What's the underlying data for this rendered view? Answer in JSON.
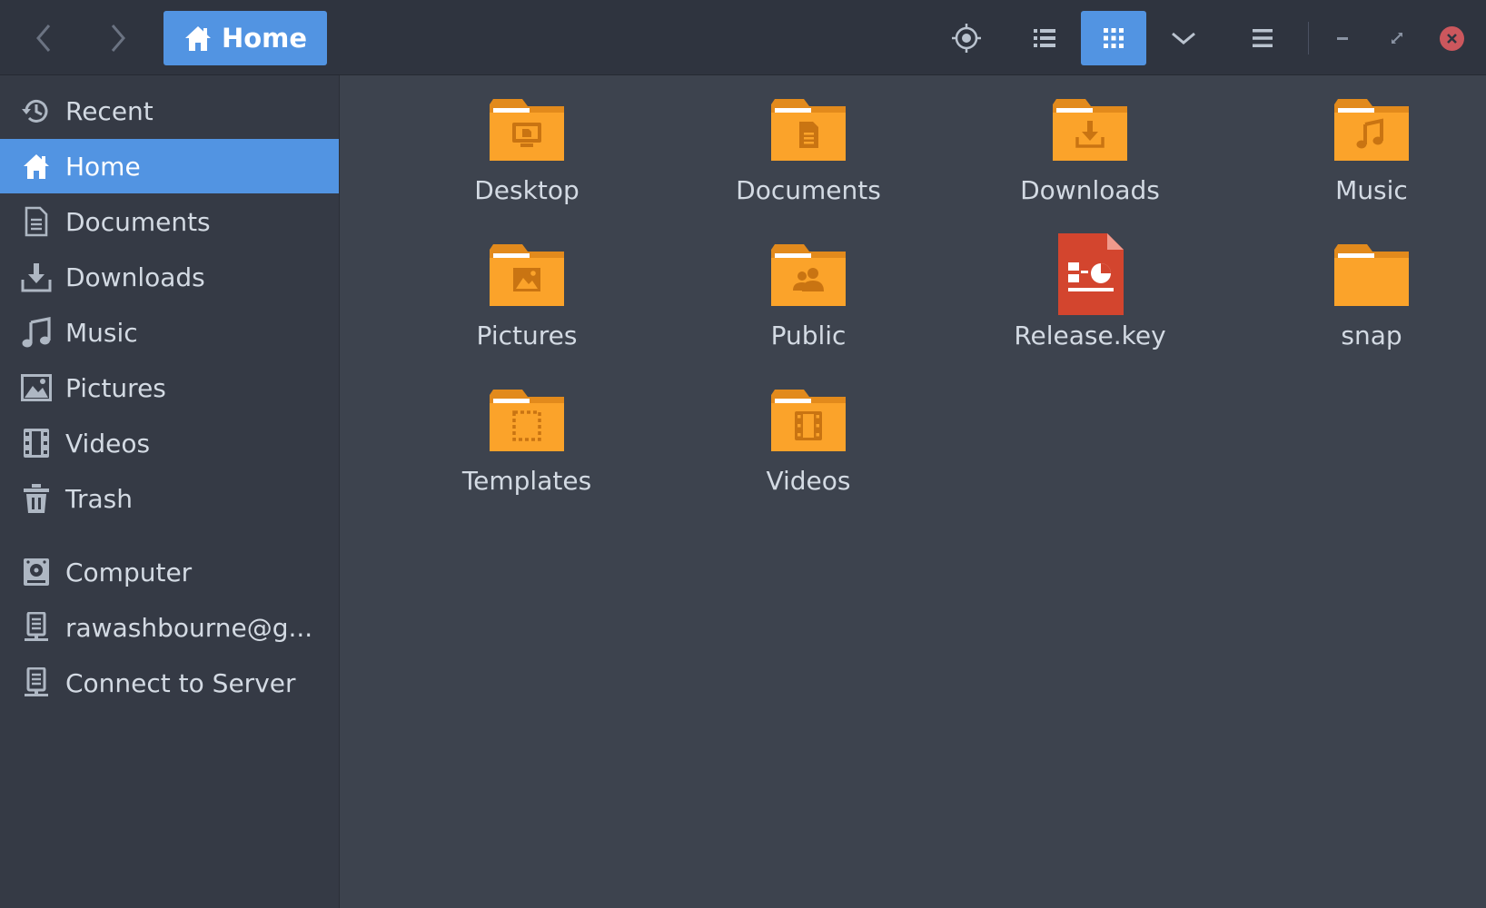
{
  "header": {
    "breadcrumb_label": "Home"
  },
  "sidebar": {
    "items": [
      {
        "label": "Recent",
        "icon": "recent-icon"
      },
      {
        "label": "Home",
        "icon": "home-icon",
        "active": true
      },
      {
        "label": "Documents",
        "icon": "documents-icon"
      },
      {
        "label": "Downloads",
        "icon": "downloads-icon"
      },
      {
        "label": "Music",
        "icon": "music-icon"
      },
      {
        "label": "Pictures",
        "icon": "pictures-icon"
      },
      {
        "label": "Videos",
        "icon": "videos-icon"
      },
      {
        "label": "Trash",
        "icon": "trash-icon"
      },
      {
        "label": "Computer",
        "icon": "computer-icon"
      },
      {
        "label": "rawashbourne@g...",
        "icon": "network-drive-icon"
      },
      {
        "label": "Connect to Server",
        "icon": "server-icon"
      }
    ]
  },
  "files": [
    {
      "name": "Desktop",
      "icon": "desktop-folder-icon"
    },
    {
      "name": "Documents",
      "icon": "documents-folder-icon"
    },
    {
      "name": "Downloads",
      "icon": "downloads-folder-icon"
    },
    {
      "name": "Music",
      "icon": "music-folder-icon"
    },
    {
      "name": "Pictures",
      "icon": "pictures-folder-icon"
    },
    {
      "name": "Public",
      "icon": "public-folder-icon"
    },
    {
      "name": "Release.key",
      "icon": "presentation-file-icon"
    },
    {
      "name": "snap",
      "icon": "folder-icon"
    },
    {
      "name": "Templates",
      "icon": "templates-folder-icon"
    },
    {
      "name": "Videos",
      "icon": "videos-folder-icon"
    }
  ],
  "colors": {
    "accent": "#5294e2",
    "folder": "#fba32a",
    "folder_dark": "#e28a1c",
    "headerbar": "#2f343f",
    "sidebar": "#353a45",
    "content": "#3d434e",
    "close": "#cc575d",
    "file_red": "#d3452e"
  }
}
